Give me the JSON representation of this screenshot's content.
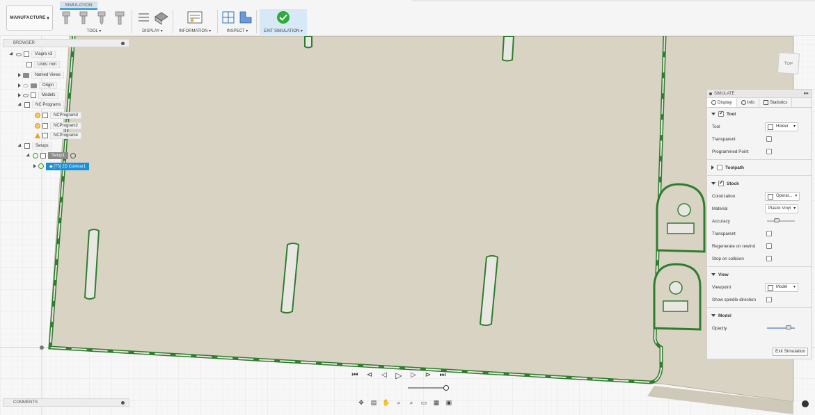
{
  "toolbar": {
    "workspace": "MANUFACTURE",
    "active_tab": "SIMULATION",
    "groups": {
      "tool": "TOOL",
      "display": "DISPLAY",
      "information": "INFORMATION",
      "inspect": "INSPECT",
      "exit_simulation": "EXIT SIMULATION"
    }
  },
  "browser": {
    "title": "BROWSER",
    "items": [
      {
        "label": "Viagra v3"
      },
      {
        "label": "Units: mm"
      },
      {
        "label": "Named Views"
      },
      {
        "label": "Origin"
      },
      {
        "label": "Models"
      },
      {
        "label": "NC Programs"
      },
      {
        "label": "NCProgram3"
      },
      {
        "label": "NCProgram2"
      },
      {
        "label": "NCProgram4"
      },
      {
        "label": "Setups"
      },
      {
        "label": "Setup1"
      },
      {
        "label": "[T5] 2D Contour1"
      }
    ]
  },
  "comments": {
    "title": "COMMENTS"
  },
  "viewcube": {
    "face": "TOP"
  },
  "simulate": {
    "title": "SIMULATE",
    "tabs": [
      "Display",
      "Info",
      "Statistics"
    ],
    "tool_section": {
      "title": "Tool",
      "tool_label": "Tool",
      "tool_value": "Holder",
      "transparent_label": "Transparent",
      "programmed_point_label": "Programmed Point"
    },
    "toolpath_section": {
      "title": "Toolpath"
    },
    "stock_section": {
      "title": "Stock",
      "colorization_label": "Colorization",
      "colorization_value": "Operat...",
      "material_label": "Material",
      "material_value": "Plastic Vinyl",
      "accuracy_label": "Accuracy",
      "accuracy_level": 0.3,
      "transparent_label": "Transparent",
      "regenerate_label": "Regenerate on rewind",
      "stop_label": "Stop on collision"
    },
    "view_section": {
      "title": "View",
      "viewpoint_label": "Viewpoint",
      "viewpoint_value": "Model",
      "spindle_label": "Show spindle direction"
    },
    "model_section": {
      "title": "Model",
      "opacity_label": "Opacity",
      "opacity_level": 0.85
    },
    "exit_button": "Exit Simulation"
  },
  "colors": {
    "stock": "#d9d3c4",
    "toolpath": "#2e9e2e",
    "selection": "#1a8fd6"
  }
}
